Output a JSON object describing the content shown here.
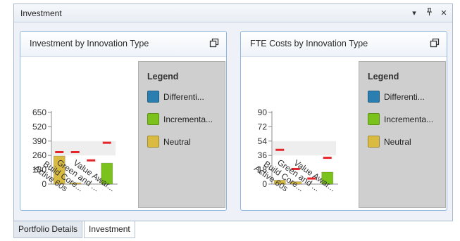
{
  "pane": {
    "title": "Investment",
    "buttons": {
      "dropdown": "▾",
      "pin": "ᚴ",
      "close": "✕"
    }
  },
  "tabs": [
    {
      "label": "Portfolio Details",
      "active": false
    },
    {
      "label": "Investment",
      "active": true
    }
  ],
  "cards": [
    {
      "title": "Investment by Innovation Type",
      "legend": {
        "title": "Legend",
        "items": [
          {
            "label": "Differenti...",
            "color": "#2a7fb0"
          },
          {
            "label": "Incrementa...",
            "color": "#7bc21c"
          },
          {
            "label": "Neutral",
            "color": "#d9bb42"
          }
        ]
      }
    },
    {
      "title": "FTE Costs by Innovation Type",
      "legend": {
        "title": "Legend",
        "items": [
          {
            "label": "Differenti...",
            "color": "#2a7fb0"
          },
          {
            "label": "Incrementa...",
            "color": "#7bc21c"
          },
          {
            "label": "Neutral",
            "color": "#d9bb42"
          }
        ]
      }
    }
  ],
  "chart_data": [
    {
      "type": "bar",
      "title": "Investment by Innovation Type",
      "categories": [
        "Active 60s",
        "Build Core...",
        "Green and ...",
        "Value Awar..."
      ],
      "yticks": [
        0,
        130,
        260,
        390,
        520,
        650
      ],
      "ylim": [
        0,
        650
      ],
      "bars": [
        {
          "category": "Active 60s",
          "value": 255,
          "color": "#d9bb42"
        },
        {
          "category": "Build Core...",
          "value": 12,
          "color": "#d9bb42"
        },
        {
          "category": "Value Awar...",
          "value": 190,
          "color": "#7bc21c"
        }
      ],
      "markers": [
        290,
        290,
        215,
        375
      ],
      "marker_color": "#e5252a",
      "grid": true,
      "legend_position": "right"
    },
    {
      "type": "bar",
      "title": "FTE Costs by Innovation Type",
      "categories": [
        "Active 60s",
        "Build Core...",
        "Green and ...",
        "Value Awar..."
      ],
      "yticks": [
        0,
        18,
        36,
        54,
        72,
        90
      ],
      "ylim": [
        0,
        90
      ],
      "bars": [
        {
          "category": "Active 60s",
          "value": 5,
          "color": "#d9bb42"
        },
        {
          "category": "Build Core...",
          "value": 3,
          "color": "#d9bb42"
        },
        {
          "category": "Value Awar...",
          "value": 15,
          "color": "#7bc21c"
        }
      ],
      "markers": [
        43,
        19,
        7,
        33
      ],
      "marker_color": "#e5252a",
      "grid": true,
      "legend_position": "right"
    }
  ]
}
